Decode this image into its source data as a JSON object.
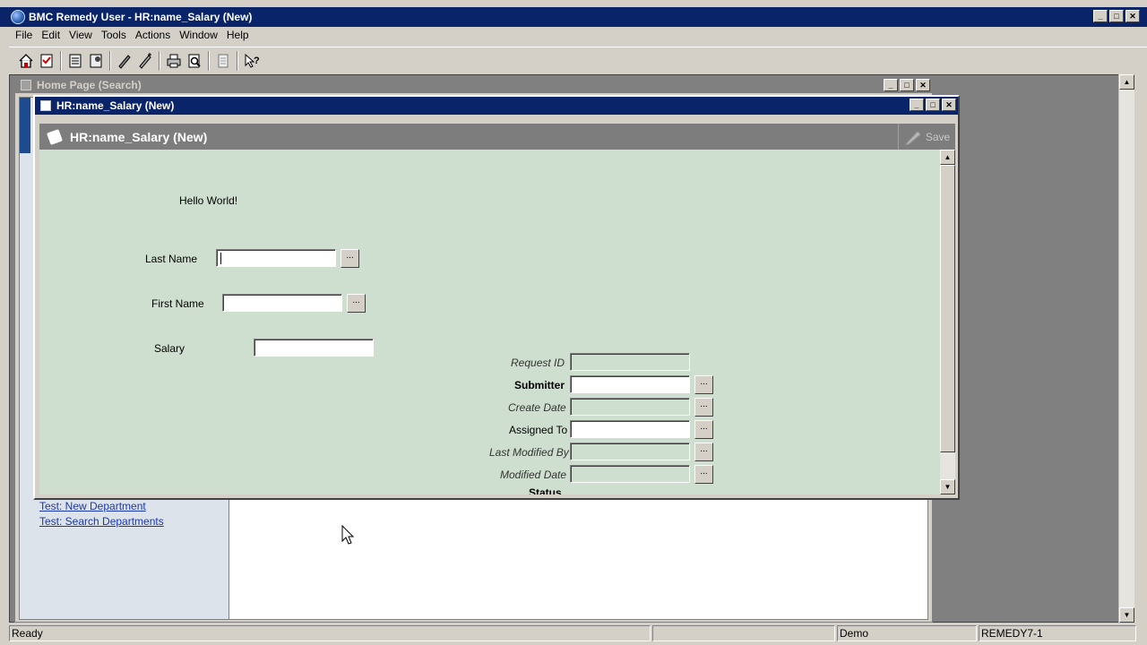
{
  "app": {
    "title": "BMC Remedy User - HR:name_Salary (New)",
    "window_buttons": [
      "_",
      "□",
      "✕"
    ]
  },
  "menu": [
    "File",
    "Edit",
    "View",
    "Tools",
    "Actions",
    "Window",
    "Help"
  ],
  "toolbar": {
    "buttons": [
      "home-icon",
      "open-icon",
      "list-icon",
      "report-icon",
      "edit-icon",
      "modify-all-icon",
      "print-icon",
      "print-preview-icon",
      "page-icon",
      "whats-this-icon"
    ]
  },
  "home_window": {
    "title": "Home Page (Search)",
    "links": [
      "Test: New Department",
      "Test: Search Departments"
    ]
  },
  "hr_window": {
    "title": "HR:name_Salary (New)",
    "header_title": "HR:name_Salary (New)",
    "save_label": "Save",
    "greeting": "Hello World!",
    "fields": {
      "last_name": {
        "label": "Last Name",
        "value": ""
      },
      "first_name": {
        "label": "First Name",
        "value": ""
      },
      "salary": {
        "label": "Salary",
        "value": ""
      },
      "request_id": {
        "label": "Request ID",
        "value": ""
      },
      "submitter": {
        "label": "Submitter",
        "value": ""
      },
      "create_date": {
        "label": "Create Date",
        "value": ""
      },
      "assigned_to": {
        "label": "Assigned To",
        "value": ""
      },
      "last_modified_by": {
        "label": "Last Modified By",
        "value": ""
      },
      "modified_date": {
        "label": "Modified Date",
        "value": ""
      }
    },
    "menu_button_label": "...",
    "status_partial": "Status"
  },
  "statusbar": {
    "message": "Ready",
    "user": "Demo",
    "server": "REMEDY7-1"
  },
  "colors": {
    "title_active": "#0a246a",
    "title_inactive": "#808080",
    "form_background": "#cfdfcf",
    "form_header": "#7d7d7d",
    "link": "#1a37b0"
  }
}
